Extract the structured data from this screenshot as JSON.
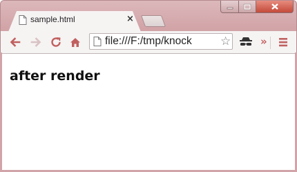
{
  "browser": {
    "tab": {
      "title": "sample.html",
      "close_label": "×"
    },
    "address_bar": {
      "url": "file:///F:/tmp/knock"
    },
    "toolbar": {
      "overflow_label": "»",
      "icons": [
        "back-arrow-icon",
        "forward-arrow-icon",
        "reload-icon",
        "home-icon",
        "page-icon",
        "bookmark-star-icon",
        "incognito-mask-icon",
        "menu-icon"
      ]
    },
    "window_buttons": [
      "minimize",
      "maximize",
      "close"
    ]
  },
  "page": {
    "text": "after render"
  },
  "colors": {
    "frame": "#d7aeb2",
    "toolbar_icon": "#c0605f",
    "close_button": "#c8503f"
  }
}
